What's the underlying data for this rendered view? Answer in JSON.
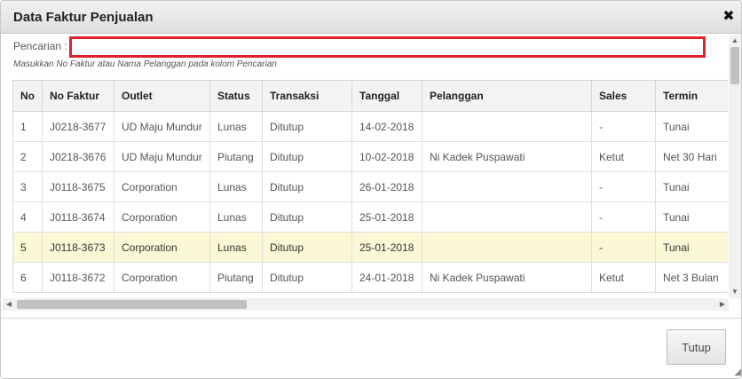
{
  "dialog": {
    "title": "Data Faktur Penjualan",
    "close_icon": "✖"
  },
  "search": {
    "label": "Pencarian :",
    "value": "",
    "placeholder": "",
    "hint": "Masukkan No Faktur atau Nama Pelanggan pada kolom Pencarian"
  },
  "table": {
    "headers": [
      "No",
      "No Faktur",
      "Outlet",
      "Status",
      "Transaksi",
      "Tanggal",
      "Pelanggan",
      "Sales",
      "Termin"
    ],
    "rows": [
      [
        "1",
        "J0218-3677",
        "UD Maju Mundur",
        "Lunas",
        "Ditutup",
        "14-02-2018",
        "",
        "-",
        "Tunai"
      ],
      [
        "2",
        "J0218-3676",
        "UD Maju Mundur",
        "Piutang",
        "Ditutup",
        "10-02-2018",
        "Ni Kadek Puspawati",
        "Ketut",
        "Net 30 Hari"
      ],
      [
        "3",
        "J0118-3675",
        "Corporation",
        "Lunas",
        "Ditutup",
        "26-01-2018",
        "",
        "-",
        "Tunai"
      ],
      [
        "4",
        "J0118-3674",
        "Corporation",
        "Lunas",
        "Ditutup",
        "25-01-2018",
        "",
        "-",
        "Tunai"
      ],
      [
        "5",
        "J0118-3673",
        "Corporation",
        "Lunas",
        "Ditutup",
        "25-01-2018",
        "",
        "-",
        "Tunai"
      ],
      [
        "6",
        "J0118-3672",
        "Corporation",
        "Piutang",
        "Ditutup",
        "24-01-2018",
        "Ni Kadek Puspawati",
        "Ketut",
        "Net 3 Bulan"
      ],
      [
        "",
        "",
        "",
        "",
        "",
        "",
        "",
        "",
        ""
      ]
    ],
    "selected_row_index": 4
  },
  "footer": {
    "close_button": "Tutup"
  },
  "colors": {
    "search_border": "#e0202a",
    "selected_row": "#fcf8d6"
  }
}
